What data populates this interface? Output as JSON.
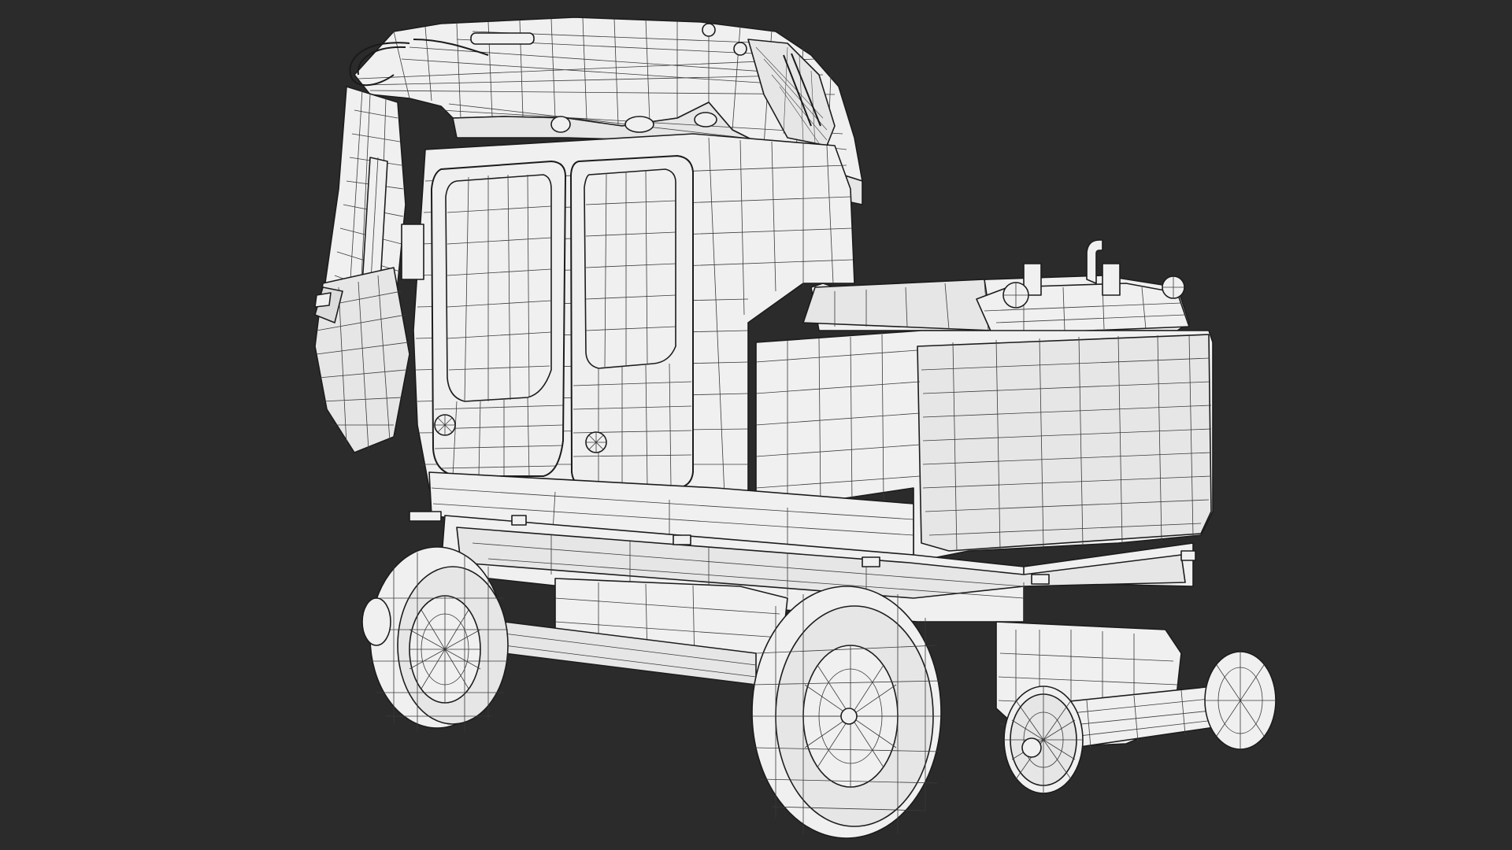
{
  "scene": {
    "subject": "wireframe-excavator-model",
    "background_color": "#2b2b2b",
    "mesh_color": "#f0f0f0",
    "wire_color": "#1c1c1c"
  }
}
